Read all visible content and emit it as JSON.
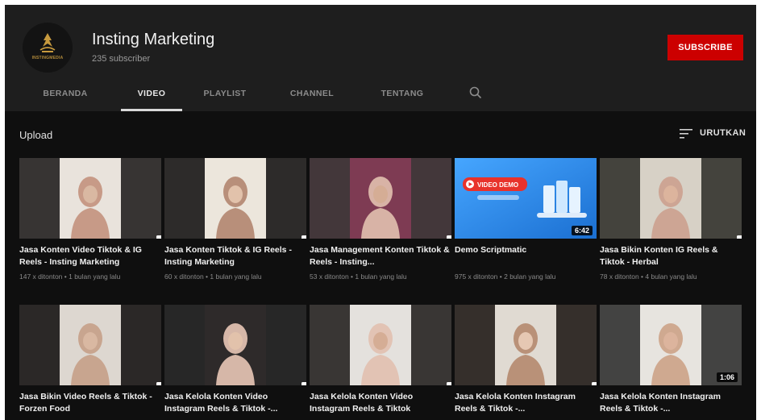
{
  "channel": {
    "name": "Insting Marketing",
    "subscribers": "235 subscriber",
    "logo_text": "INSTINGMEDIA",
    "subscribe_label": "SUBSCRIBE"
  },
  "tabs": [
    {
      "label": "BERANDA",
      "active": false
    },
    {
      "label": "VIDEO",
      "active": true
    },
    {
      "label": "PLAYLIST",
      "active": false
    },
    {
      "label": "CHANNEL",
      "active": false
    },
    {
      "label": "TENTANG",
      "active": false
    }
  ],
  "section": {
    "title": "Upload",
    "sort_label": "URUTKAN"
  },
  "videos": [
    {
      "title": "Jasa Konten Video Tiktok & IG Reels - Insting Marketing",
      "meta": "147 x ditonton • 1 bulan yang lalu",
      "badge": "shorts"
    },
    {
      "title": "Jasa Konten Tiktok & IG Reels - Insting Marketing",
      "meta": "60 x ditonton • 1 bulan yang lalu",
      "badge": "shorts"
    },
    {
      "title": "Jasa Management Konten Tiktok & Reels - Insting...",
      "meta": "53 x ditonton • 1 bulan yang lalu",
      "badge": "shorts"
    },
    {
      "title": "Demo Scriptmatic",
      "meta": "975 x ditonton • 2 bulan yang lalu",
      "badge": "duration",
      "duration": "6:42",
      "thumb_label": "VIDEO DEMO"
    },
    {
      "title": "Jasa Bikin Konten IG Reels & Tiktok - Herbal",
      "meta": "78 x ditonton • 4 bulan yang lalu",
      "badge": "shorts"
    },
    {
      "title": "Jasa Bikin Video Reels & Tiktok - Forzen Food",
      "meta": "",
      "badge": "shorts"
    },
    {
      "title": "Jasa Kelola Konten Video Instagram Reels & Tiktok -...",
      "meta": "",
      "badge": "shorts"
    },
    {
      "title": "Jasa Kelola Konten Video Instagram Reels & Tiktok",
      "meta": "",
      "badge": "shorts"
    },
    {
      "title": "Jasa Kelola Konten Instagram Reels & Tiktok -...",
      "meta": "",
      "badge": "shorts"
    },
    {
      "title": "Jasa Kelola Konten Instagram Reels & Tiktok -...",
      "meta": "",
      "badge": "duration",
      "duration": "1:06"
    }
  ],
  "icons": {
    "search": "search-icon",
    "sort": "sort-icon",
    "shorts": "shorts-icon"
  },
  "colors": {
    "background": "#0f0f0f",
    "header": "#1e1e1e",
    "subscribe": "#cc0000",
    "shorts_badge": "#e62117",
    "demo_thumb": "#2d8ef0"
  }
}
